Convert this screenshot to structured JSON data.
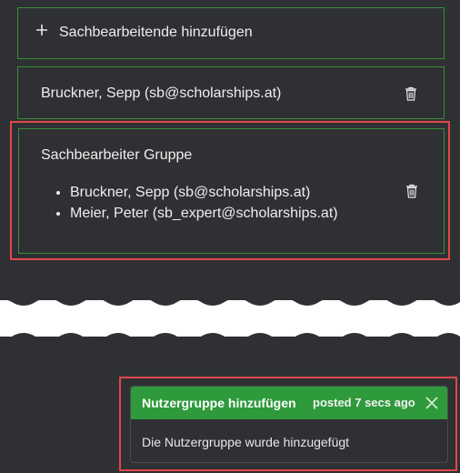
{
  "assignees": {
    "add_label": "Sachbearbeitende hinzufügen",
    "single_user": "Bruckner, Sepp (sb@scholarships.at)",
    "group": {
      "title": "Sachbearbeiter Gruppe",
      "members": [
        "Bruckner, Sepp (sb@scholarships.at)",
        "Meier, Peter (sb_expert@scholarships.at)"
      ]
    }
  },
  "toast": {
    "title": "Nutzergruppe hinzufügen",
    "time": "posted 7 secs ago",
    "message": "Die Nutzergruppe wurde hinzugefügt"
  },
  "colors": {
    "panel_bg": "#2e3033",
    "box_border": "#3a8e3a",
    "highlight": "#e0474c",
    "toast_header": "#2e9a3c"
  }
}
